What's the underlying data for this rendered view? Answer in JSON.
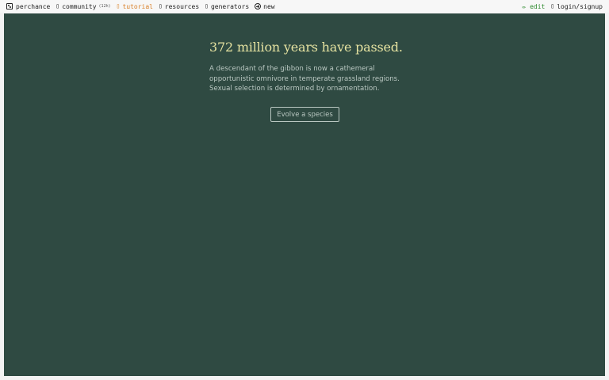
{
  "topbar": {
    "items": [
      {
        "label": "perchance",
        "icon": "dice-icon"
      },
      {
        "label": "community",
        "badge": "(12h)",
        "icon": "chat-icon"
      },
      {
        "label": "tutorial",
        "icon": "book-icon"
      },
      {
        "label": "resources",
        "icon": "folder-icon"
      },
      {
        "label": "generators",
        "icon": "grid-icon"
      },
      {
        "label": "new",
        "icon": "plus-circle-icon"
      }
    ],
    "edit": "✏ edit",
    "login": "login/signup",
    "colors": {
      "tutorial": "#d9822b",
      "edit": "#2e8b2e"
    }
  },
  "main": {
    "headline": "372 million years have passed.",
    "description": "A descendant of the gibbon is now a cathemeral opportunistic omnivore in temperate grassland regions. Sexual selection is determined by ornamentation.",
    "button_label": "Evolve a species",
    "colors": {
      "background": "#2f4a42",
      "headline": "#e6e3a1",
      "text": "#b9c7c1"
    }
  }
}
